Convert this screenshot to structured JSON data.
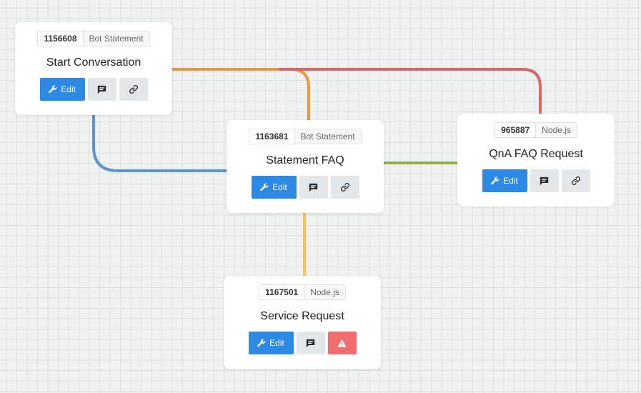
{
  "nodes": [
    {
      "key": "start",
      "id": "1156608",
      "type": "Bot Statement",
      "title": "Start Conversation",
      "edit_label": "Edit",
      "buttons": [
        "edit-button",
        "comment-button",
        "link-button"
      ]
    },
    {
      "key": "faq",
      "id": "1163681",
      "type": "Bot Statement",
      "title": "Statement FAQ",
      "edit_label": "Edit",
      "buttons": [
        "edit-button",
        "comment-button",
        "link-button"
      ]
    },
    {
      "key": "qna",
      "id": "965887",
      "type": "Node.js",
      "title": "QnA FAQ Request",
      "edit_label": "Edit",
      "buttons": [
        "edit-button",
        "comment-button",
        "link-button"
      ]
    },
    {
      "key": "service",
      "id": "1167501",
      "type": "Node.js",
      "title": "Service Request",
      "edit_label": "Edit",
      "buttons": [
        "edit-button",
        "comment-button",
        "warning-button"
      ]
    }
  ],
  "connections": [
    {
      "from": "start",
      "to": "faq",
      "color": "#e8993d"
    },
    {
      "from": "start",
      "to": "qna",
      "color": "#dd6464"
    },
    {
      "from": "start",
      "to": "faq",
      "color": "#5b93d3"
    },
    {
      "from": "faq",
      "to": "qna",
      "color": "#8ab24a"
    },
    {
      "from": "faq",
      "to": "service",
      "color": "#f5c25a"
    }
  ],
  "colors": {
    "edit_button": "#2d89e6",
    "warning_button": "#f26d6d",
    "secondary_button": "#e4e7e9"
  },
  "icons": {
    "edit": "wrench-icon",
    "comment": "comment-icon",
    "link": "link-icon",
    "warning": "warning-icon"
  }
}
